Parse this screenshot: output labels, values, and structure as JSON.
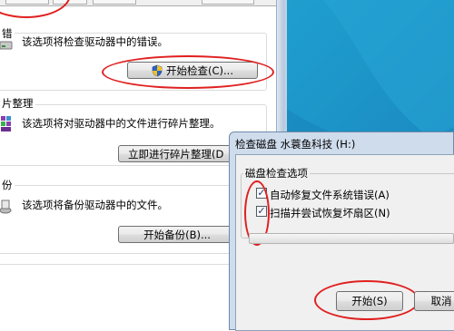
{
  "properties": {
    "tabs": [
      "",
      "",
      "",
      ""
    ],
    "error_check": {
      "group_label": "错",
      "description": "该选项将检查驱动器中的错误。",
      "button_label": "开始检查(C)..."
    },
    "defrag": {
      "group_label": "片整理",
      "description": "该选项将对驱动器中的文件进行碎片整理。",
      "button_label": "立即进行碎片整理(D"
    },
    "backup": {
      "group_label": "份",
      "description": "该选项将备份驱动器中的文件。",
      "button_label": "开始备份(B)..."
    }
  },
  "check_disk_dialog": {
    "title": "检查磁盘 水蓑鱼科技 (H:)",
    "group_label": "磁盘检查选项",
    "options": [
      {
        "label": "自动修复文件系统错误(A)",
        "checked": true
      },
      {
        "label": "扫描并尝试恢复坏扇区(N)",
        "checked": true
      }
    ],
    "progress": 0,
    "start_label": "开始(S)",
    "cancel_label": "取消"
  },
  "colors": {
    "annotation": "#e02020",
    "desktop": "#1b8dc2",
    "dialog_frame": "#cfdcec"
  },
  "icons": [
    "drive-icon",
    "defrag-icon",
    "backup-icon",
    "shield-icon",
    "close-icon"
  ]
}
